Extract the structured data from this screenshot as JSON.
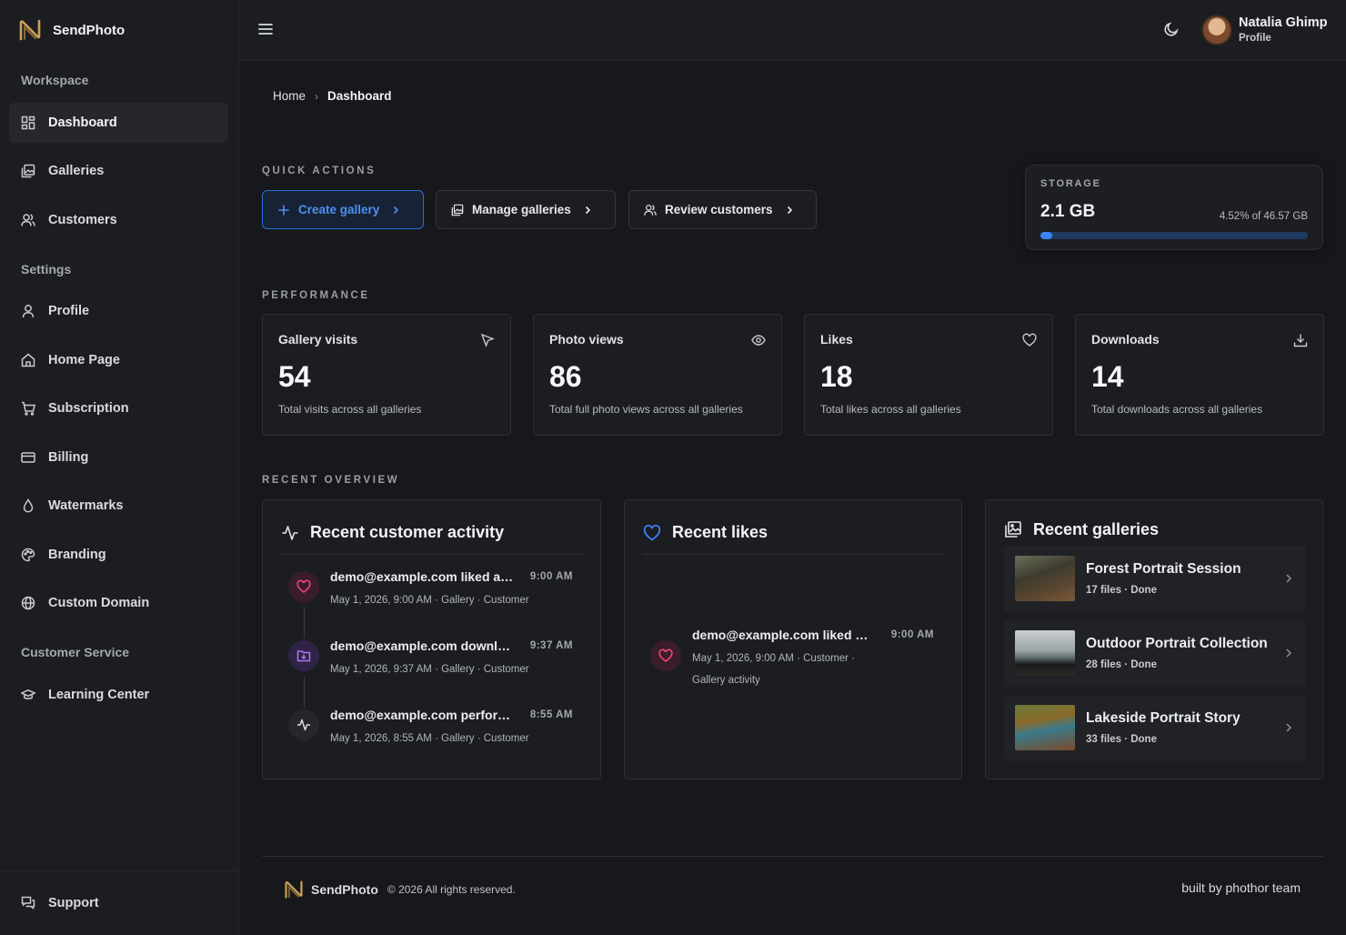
{
  "app": {
    "name": "SendPhoto",
    "accent": "#3b82f6"
  },
  "sidebar": {
    "sections": [
      "Workspace",
      "Settings",
      "Customer Service"
    ],
    "items": [
      {
        "label": "Dashboard",
        "icon": "dashboard-icon",
        "active": true
      },
      {
        "label": "Galleries",
        "icon": "gallery-icon"
      },
      {
        "label": "Customers",
        "icon": "users-icon"
      },
      {
        "label": "Profile",
        "icon": "user-icon"
      },
      {
        "label": "Home Page",
        "icon": "home-icon"
      },
      {
        "label": "Subscription",
        "icon": "cart-icon"
      },
      {
        "label": "Billing",
        "icon": "card-icon"
      },
      {
        "label": "Watermarks",
        "icon": "droplet-icon"
      },
      {
        "label": "Branding",
        "icon": "palette-icon"
      },
      {
        "label": "Custom Domain",
        "icon": "globe-icon"
      },
      {
        "label": "Learning Center",
        "icon": "graduation-cap-icon"
      }
    ],
    "support": {
      "label": "Support",
      "icon": "chat-icon"
    }
  },
  "topbar": {
    "user_name": "Natalia Ghimp",
    "user_sub": "Profile"
  },
  "breadcrumb": {
    "home": "Home",
    "current": "Dashboard"
  },
  "quick_actions": {
    "label": "QUICK ACTIONS",
    "buttons": [
      "Create gallery",
      "Manage galleries",
      "Review customers"
    ]
  },
  "storage": {
    "label": "STORAGE",
    "value": "2.1 GB",
    "percent_text": "4.52% of 46.57 GB",
    "percent": 4.52
  },
  "performance": {
    "label": "PERFORMANCE",
    "cards": [
      {
        "title": "Gallery visits",
        "value": "54",
        "desc": "Total visits across all galleries",
        "icon": "cursor-icon"
      },
      {
        "title": "Photo views",
        "value": "86",
        "desc": "Total full photo views across all galleries",
        "icon": "eye-icon"
      },
      {
        "title": "Likes",
        "value": "18",
        "desc": "Total likes across all galleries",
        "icon": "heart-icon"
      },
      {
        "title": "Downloads",
        "value": "14",
        "desc": "Total downloads across all galleries",
        "icon": "download-icon"
      }
    ]
  },
  "overview": {
    "label": "RECENT OVERVIEW",
    "activity": {
      "title": "Recent customer activity",
      "items": [
        {
          "title": "demo@example.com liked a photo",
          "time": "9:00 AM",
          "meta": "May 1, 2026, 9:00 AM  ·  Gallery  ·  Customer",
          "icon": "heart-icon"
        },
        {
          "title": "demo@example.com downloaded",
          "time": "9:37 AM",
          "meta": "May 1, 2026, 9:37 AM  ·  Gallery  ·  Customer",
          "icon": "folder-download-icon"
        },
        {
          "title": "demo@example.com performed",
          "time": "8:55 AM",
          "meta": "May 1, 2026, 8:55 AM  ·  Gallery  ·  Customer",
          "icon": "activity-icon"
        }
      ]
    },
    "likes": {
      "title": "Recent likes",
      "items": [
        {
          "title": "demo@example.com liked a photo",
          "time": "9:00 AM",
          "meta1": "May 1, 2026, 9:00 AM  ·  Customer  ·",
          "meta2": "Gallery activity"
        }
      ]
    },
    "galleries": {
      "title": "Recent galleries",
      "items": [
        {
          "title": "Forest Portrait Session",
          "sub": "17 files · Done"
        },
        {
          "title": "Outdoor Portrait Collection",
          "sub": "28 files · Done"
        },
        {
          "title": "Lakeside Portrait Story",
          "sub": "33 files · Done"
        }
      ]
    }
  },
  "footer": {
    "brand": "SendPhoto",
    "copy": "© 2026 All rights reserved.",
    "right": "built by phothor team"
  }
}
